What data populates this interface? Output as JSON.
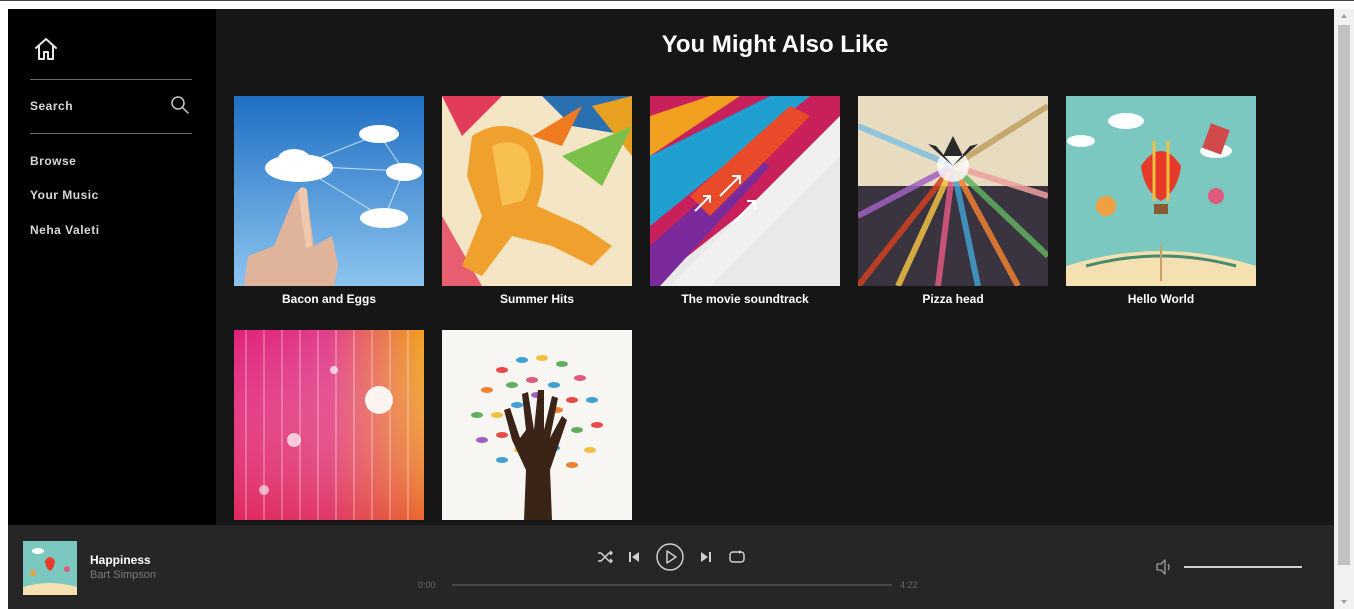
{
  "sidebar": {
    "home_icon": "home-icon",
    "search": {
      "label": "Search",
      "icon": "search-icon"
    },
    "nav": [
      {
        "label": "Browse"
      },
      {
        "label": "Your Music"
      },
      {
        "label": "Neha Valeti"
      }
    ]
  },
  "main": {
    "title": "You Might Also Like",
    "albums": [
      {
        "title": "Bacon and Eggs"
      },
      {
        "title": "Summer Hits"
      },
      {
        "title": "The movie soundtrack"
      },
      {
        "title": "Pizza head"
      },
      {
        "title": "Hello World"
      },
      {
        "title": ""
      },
      {
        "title": ""
      }
    ]
  },
  "player": {
    "track": {
      "title": "Happiness",
      "artist": "Bart Simpson"
    },
    "controls": [
      "shuffle-icon",
      "previous-icon",
      "play-icon",
      "next-icon",
      "repeat-icon"
    ],
    "time_current": "0:00",
    "time_total": "4:22",
    "progress": 0,
    "volume_icon": "volume-icon",
    "volume": 1.0
  },
  "colors": {
    "sidebar_bg": "#000000",
    "main_bg": "#161616",
    "player_bg": "#262626",
    "text": "#ffffff"
  }
}
